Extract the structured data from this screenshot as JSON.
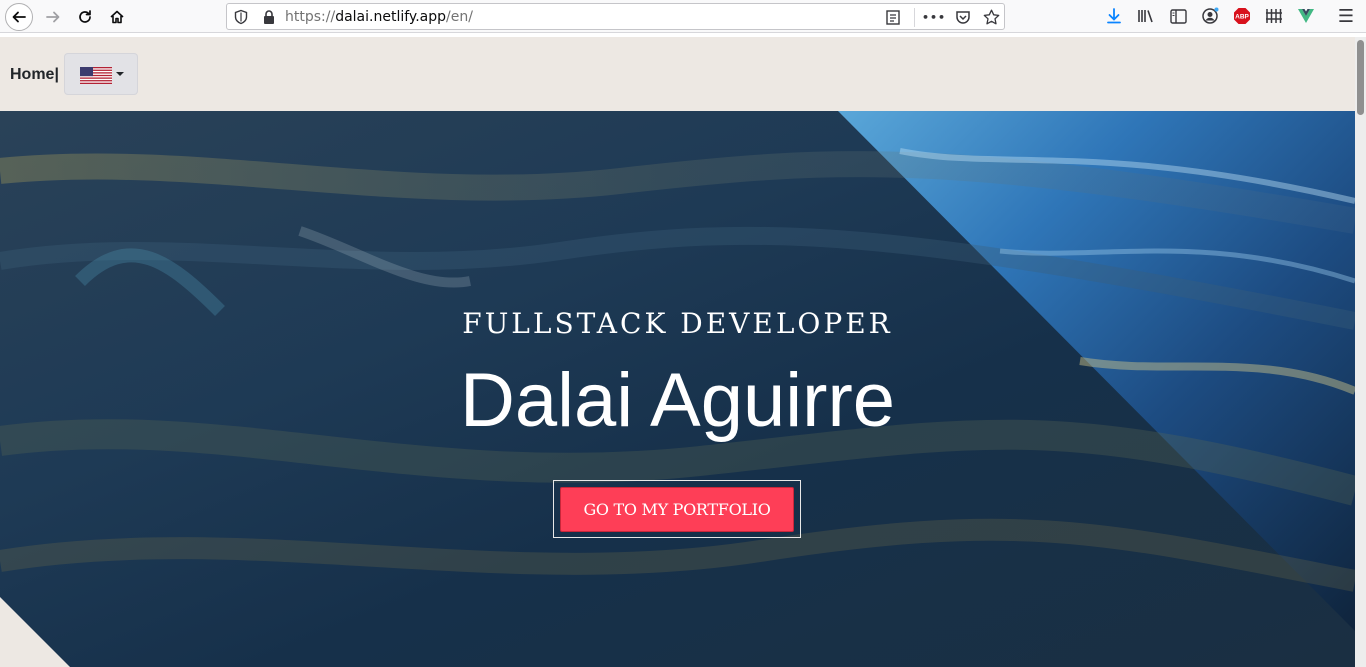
{
  "browser": {
    "url_prefix": "https://",
    "url_host": "dalai.netlify.app",
    "url_path": "/en/",
    "menu_glyph": "☰",
    "more_glyph": "•••",
    "abp_label": "ABP"
  },
  "nav": {
    "home_label": "Home|",
    "language": "English (US flag)"
  },
  "hero": {
    "subtitle": "FULLSTACK DEVELOPER",
    "title": "Dalai Aguirre",
    "cta_label": "GO TO MY PORTFOLIO"
  },
  "colors": {
    "navbar_bg": "#ede8e3",
    "cta_bg": "#fe3e57",
    "hero_dark": "#1c3147",
    "hero_bright": "#2f8fd8"
  }
}
